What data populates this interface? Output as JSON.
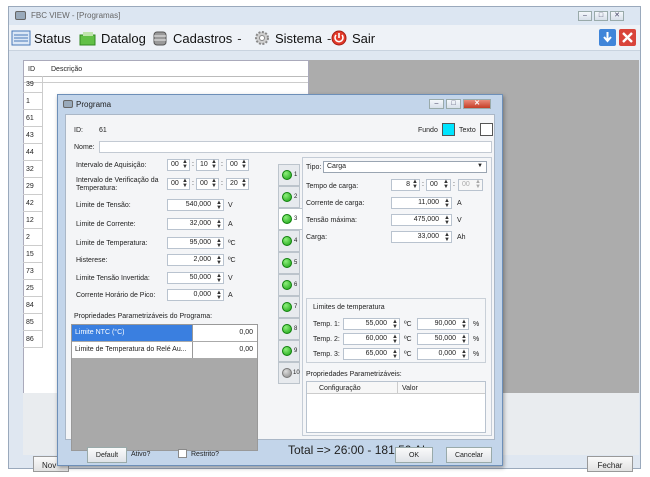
{
  "window": {
    "title": "FBC VIEW - [Programas]",
    "ctrl_min": "‒",
    "ctrl_max": "□",
    "ctrl_close": "✕"
  },
  "menu": {
    "status": "Status",
    "datalog": "Datalog",
    "cadastros": "Cadastros",
    "sistema": "Sistema",
    "sair": "Sair",
    "dash": "-"
  },
  "list": {
    "col_id": "ID",
    "col_desc": "Descrição",
    "ids": [
      "39",
      "1",
      "61",
      "43",
      "44",
      "32",
      "29",
      "42",
      "12",
      "2",
      "15",
      "73",
      "25",
      "84",
      "85",
      "86"
    ]
  },
  "buttons_bg": {
    "novo": "Nov",
    "fechar": "Fechar"
  },
  "dialog": {
    "title": "Programa",
    "id_label": "ID:",
    "id_value": "61",
    "nome_label": "Nome:",
    "fundo_label": "Fundo",
    "texto_label": "Texto",
    "fundo_color": "#00e5ff",
    "params": [
      {
        "label": "Intervalo de Aquisição:",
        "h": "00",
        "m": "10",
        "s": "00"
      },
      {
        "label": "Intervalo de Verificação da Temperatura:",
        "h": "00",
        "m": "00",
        "s": "20"
      },
      {
        "label": "Limite de Tensão:",
        "value": "540,000",
        "unit": "V"
      },
      {
        "label": "Limite de Corrente:",
        "value": "32,000",
        "unit": "A"
      },
      {
        "label": "Limite de Temperatura:",
        "value": "95,000",
        "unit": "ºC"
      },
      {
        "label": "Histerese:",
        "value": "2,000",
        "unit": "ºC"
      },
      {
        "label": "Limite Tensão Invertida:",
        "value": "50,000",
        "unit": "V"
      },
      {
        "label": "Corrente Horário de Pico:",
        "value": "0,000",
        "unit": "A"
      }
    ],
    "props_title": "Propriedades Parametrizáveis do Programa:",
    "props": [
      {
        "key": "Limite NTC (°C)",
        "value": "0,00"
      },
      {
        "key": "Limite de Temperatura do Relé Au...",
        "value": "0,00"
      }
    ],
    "tabs": [
      "1",
      "2",
      "3",
      "4",
      "5",
      "6",
      "7",
      "8",
      "9",
      "10"
    ],
    "tipo_label": "Tipo:",
    "tipo_value": "Carga",
    "tempo_label": "Tempo de carga:",
    "tempo_h": "8",
    "tempo_m": "00",
    "tempo_s": "00",
    "corrente_label": "Corrente de carga:",
    "corrente_value": "11,000",
    "corrente_unit": "A",
    "tensao_label": "Tensão máxima:",
    "tensao_value": "475,000",
    "tensao_unit": "V",
    "carga_label": "Carga:",
    "carga_value": "33,000",
    "carga_unit": "Ah",
    "limits_title": "Limites de temperatura",
    "temps": [
      {
        "label": "Temp. 1:",
        "value": "55,000",
        "pct": "90,000"
      },
      {
        "label": "Temp. 2:",
        "value": "60,000",
        "pct": "50,000"
      },
      {
        "label": "Temp. 3:",
        "value": "65,000",
        "pct": "0,000"
      }
    ],
    "temp_unit": "ºC",
    "pct_unit": "%",
    "pp2_title": "Propriedades Parametrizáveis:",
    "pp2_col1": "Configuração",
    "pp2_col2": "Valor",
    "total": "Total => 26:00 - 181,50 Ah",
    "default_btn": "Default",
    "ativo_label": "Ativo?",
    "restrito_label": "Restrito?",
    "ok_btn": "OK",
    "cancel_btn": "Cancelar"
  }
}
